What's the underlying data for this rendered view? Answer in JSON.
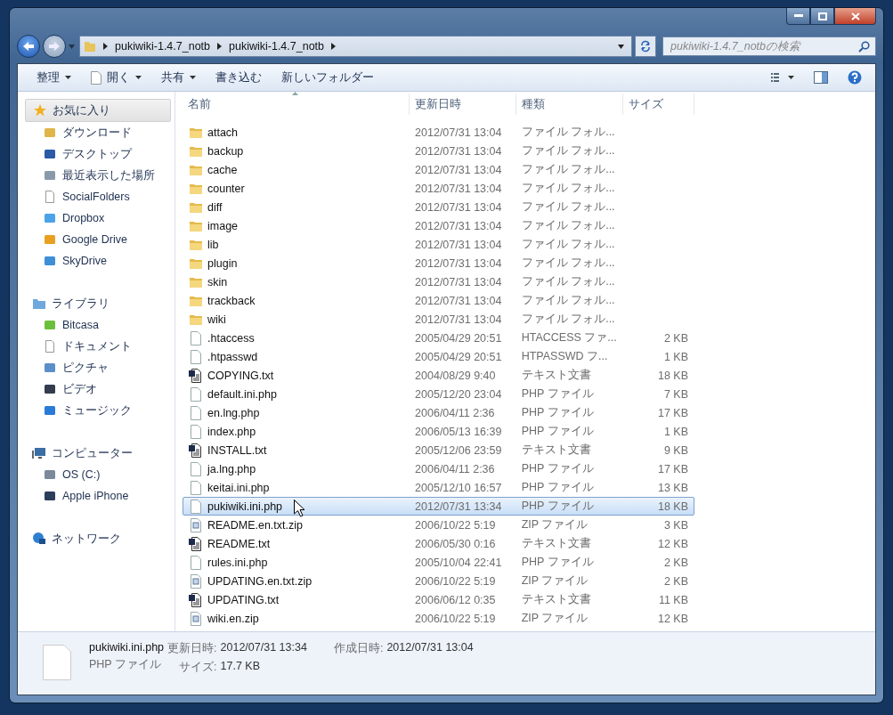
{
  "address": {
    "segments": [
      "pukiwiki-1.4.7_notb",
      "pukiwiki-1.4.7_notb"
    ]
  },
  "search": {
    "placeholder": "pukiwiki-1.4.7_notbの検索"
  },
  "toolbar": {
    "buttons": [
      {
        "label": "整理",
        "dropdown": true
      },
      {
        "label": "開く",
        "dropdown": true
      },
      {
        "label": "共有",
        "dropdown": true
      },
      {
        "label": "書き込む",
        "dropdown": false
      },
      {
        "label": "新しいフォルダー",
        "dropdown": false
      }
    ]
  },
  "sidebar": {
    "groups": [
      {
        "label": "お気に入り",
        "selected": true,
        "children": [
          {
            "label": "ダウンロード",
            "selected": false
          },
          {
            "label": "デスクトップ",
            "selected": false
          },
          {
            "label": "最近表示した場所",
            "selected": false
          },
          {
            "label": "SocialFolders",
            "selected": false
          },
          {
            "label": "Dropbox",
            "selected": false
          },
          {
            "label": "Google Drive",
            "selected": false
          },
          {
            "label": "SkyDrive",
            "selected": false
          }
        ]
      },
      {
        "label": "ライブラリ",
        "selected": false,
        "children": [
          {
            "label": "Bitcasa",
            "selected": false
          },
          {
            "label": "ドキュメント",
            "selected": false
          },
          {
            "label": "ピクチャ",
            "selected": false
          },
          {
            "label": "ビデオ",
            "selected": false
          },
          {
            "label": "ミュージック",
            "selected": false
          }
        ]
      },
      {
        "label": "コンピューター",
        "selected": false,
        "children": [
          {
            "label": "OS (C:)",
            "selected": false
          },
          {
            "label": "Apple iPhone",
            "selected": false
          }
        ]
      },
      {
        "label": "ネットワーク",
        "selected": false
      }
    ]
  },
  "table": {
    "columns": [
      {
        "label": "名前",
        "sorted": true
      },
      {
        "label": "更新日時",
        "sorted": false
      },
      {
        "label": "種類",
        "sorted": false
      },
      {
        "label": "サイズ",
        "sorted": false
      }
    ],
    "rows": [
      {
        "kind": "folder",
        "name": "attach",
        "date": "2012/07/31 13:04",
        "type": "ファイル フォル...",
        "selected": false
      },
      {
        "kind": "folder",
        "name": "backup",
        "date": "2012/07/31 13:04",
        "type": "ファイル フォル...",
        "selected": false
      },
      {
        "kind": "folder",
        "name": "cache",
        "date": "2012/07/31 13:04",
        "type": "ファイル フォル...",
        "selected": false
      },
      {
        "kind": "folder",
        "name": "counter",
        "date": "2012/07/31 13:04",
        "type": "ファイル フォル...",
        "selected": false
      },
      {
        "kind": "folder",
        "name": "diff",
        "date": "2012/07/31 13:04",
        "type": "ファイル フォル...",
        "selected": false
      },
      {
        "kind": "folder",
        "name": "image",
        "date": "2012/07/31 13:04",
        "type": "ファイル フォル...",
        "selected": false
      },
      {
        "kind": "folder",
        "name": "lib",
        "date": "2012/07/31 13:04",
        "type": "ファイル フォル...",
        "selected": false
      },
      {
        "kind": "folder",
        "name": "plugin",
        "date": "2012/07/31 13:04",
        "type": "ファイル フォル...",
        "selected": false
      },
      {
        "kind": "folder",
        "name": "skin",
        "date": "2012/07/31 13:04",
        "type": "ファイル フォル...",
        "selected": false
      },
      {
        "kind": "folder",
        "name": "trackback",
        "date": "2012/07/31 13:04",
        "type": "ファイル フォル...",
        "selected": false
      },
      {
        "kind": "folder",
        "name": "wiki",
        "date": "2012/07/31 13:04",
        "type": "ファイル フォル...",
        "selected": false
      },
      {
        "kind": "file",
        "name": ".htaccess",
        "date": "2005/04/29 20:51",
        "type": "HTACCESS ファ...",
        "size": "2 KB",
        "selected": false
      },
      {
        "kind": "file",
        "name": ".htpasswd",
        "date": "2005/04/29 20:51",
        "type": "HTPASSWD フ...",
        "size": "1 KB",
        "selected": false
      },
      {
        "kind": "text",
        "name": "COPYING.txt",
        "date": "2004/08/29 9:40",
        "type": "テキスト文書",
        "size": "18 KB",
        "selected": false
      },
      {
        "kind": "file",
        "name": "default.ini.php",
        "date": "2005/12/20 23:04",
        "type": "PHP ファイル",
        "size": "7 KB",
        "selected": false
      },
      {
        "kind": "file",
        "name": "en.lng.php",
        "date": "2006/04/11 2:36",
        "type": "PHP ファイル",
        "size": "17 KB",
        "selected": false
      },
      {
        "kind": "file",
        "name": "index.php",
        "date": "2006/05/13 16:39",
        "type": "PHP ファイル",
        "size": "1 KB",
        "selected": false
      },
      {
        "kind": "text",
        "name": "INSTALL.txt",
        "date": "2005/12/06 23:59",
        "type": "テキスト文書",
        "size": "9 KB",
        "selected": false
      },
      {
        "kind": "file",
        "name": "ja.lng.php",
        "date": "2006/04/11 2:36",
        "type": "PHP ファイル",
        "size": "17 KB",
        "selected": false
      },
      {
        "kind": "file",
        "name": "keitai.ini.php",
        "date": "2005/12/10 16:57",
        "type": "PHP ファイル",
        "size": "13 KB",
        "selected": false
      },
      {
        "kind": "file",
        "name": "pukiwiki.ini.php",
        "date": "2012/07/31 13:34",
        "type": "PHP ファイル",
        "size": "18 KB",
        "selected": true
      },
      {
        "kind": "zip",
        "name": "README.en.txt.zip",
        "date": "2006/10/22 5:19",
        "type": "ZIP ファイル",
        "size": "3 KB",
        "selected": false
      },
      {
        "kind": "text",
        "name": "README.txt",
        "date": "2006/05/30 0:16",
        "type": "テキスト文書",
        "size": "12 KB",
        "selected": false
      },
      {
        "kind": "file",
        "name": "rules.ini.php",
        "date": "2005/10/04 22:41",
        "type": "PHP ファイル",
        "size": "2 KB",
        "selected": false
      },
      {
        "kind": "zip",
        "name": "UPDATING.en.txt.zip",
        "date": "2006/10/22 5:19",
        "type": "ZIP ファイル",
        "size": "2 KB",
        "selected": false
      },
      {
        "kind": "text",
        "name": "UPDATING.txt",
        "date": "2006/06/12 0:35",
        "type": "テキスト文書",
        "size": "11 KB",
        "selected": false
      },
      {
        "kind": "zip",
        "name": "wiki.en.zip",
        "date": "2006/10/22 5:19",
        "type": "ZIP ファイル",
        "size": "12 KB",
        "selected": false
      }
    ]
  },
  "details": {
    "name": "pukiwiki.ini.php",
    "type": "PHP ファイル",
    "fields": [
      {
        "label": "更新日時:",
        "value": "2012/07/31 13:34"
      },
      {
        "label": "作成日時:",
        "value": "2012/07/31 13:04"
      },
      {
        "label": "サイズ:",
        "value": "17.7 KB"
      }
    ]
  }
}
